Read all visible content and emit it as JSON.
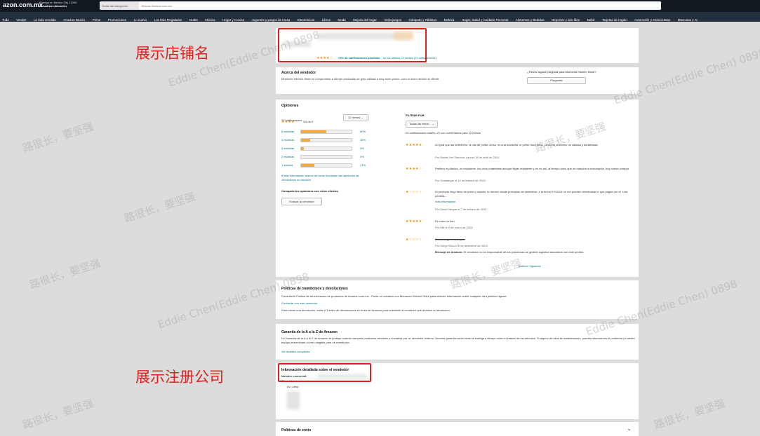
{
  "header": {
    "logo": "azon.com.mx",
    "deliver_line1": "Entrega en Mexico City 11000",
    "deliver_line2": "Actualizar ubicación",
    "search_category": "Todas las categorías",
    "search_placeholder": "Buscar Amazon.com.mx"
  },
  "nav": [
    "Todo",
    "Vender",
    "Lo más vendido",
    "Amazon Basics",
    "Prime",
    "Promociones",
    "Lo nuevo",
    "Los Más Regalados",
    "Outlet",
    "Música",
    "Hogar y Cocina",
    "Juguetes y juegos de mesa",
    "Electrónicos",
    "Libros",
    "Moda",
    "Mejora del hogar",
    "Videojuegos",
    "Cómputo y Tabletas",
    "Belleza",
    "Hogar, Salud y Cuidado Personal",
    "Alimentos y Bebidas",
    "Deportes y aire libre",
    "Bebé",
    "Tarjetas de regalo",
    "Automotriz y Motocicletas",
    "Mascotas y Ar"
  ],
  "seller_header": {
    "rating_stars": 4.5,
    "rating_link": "73% de calificaciones positivas",
    "rating_suffix": "en los últimos 12 meses (22 calificaciones)"
  },
  "about": {
    "title": "Acerca del vendedor",
    "text": "Momento Kitchen Store se compromete a ofrecer productos de gran calidad a muy buen precio, con un buen servicio al cliente.",
    "question": "¿Tienes alguna pregunta para Momento Kitchen Store?",
    "ask_button": "Preguntar"
  },
  "reviews_panel": {
    "title": "Opiniones",
    "score_text": "3.6 de 5",
    "count_text": "22 calificaciones",
    "period_select": "12 meses",
    "histogram": [
      {
        "label": "5 estrellas",
        "percent": 50
      },
      {
        "label": "4 estrellas",
        "percent": 18
      },
      {
        "label": "3 estrellas",
        "percent": 5
      },
      {
        "label": "2 estrellas",
        "percent": 0
      },
      {
        "label": "1 estrella",
        "percent": 27
      }
    ],
    "more_info": "Más información acerca de cómo funcionan las opiniones de vendedores en Amazon",
    "share_title": "Comparte tus opiniones con otros clientes",
    "evaluate_button": "Evaluar al vendedor",
    "filter_title": "FILTRAR POR",
    "filter_select": "Todas las estrel...",
    "summary": "22 calificaciones totales, 22 con comentarios para 12 meses",
    "next_link": "Anterior  Siguiente"
  },
  "reviews": [
    {
      "stars": 5,
      "text": "Al igual que las anteriores, la olla de peltre Cinsa, es una maravilla, el peltre dura años. Cinsa es sinónimo de calidad y durabilidad.",
      "author": "Por Rafael Ver Sánchez Lara el 19 de abril de 2024."
    },
    {
      "stars": 4,
      "text": "Prefiero el plástico, es resistente, los otros materiales aunque digan resistente y no es así, al tiempo claro que se mancha o desconpela, hoy buena compra.",
      "author": "Por Guadalupe el 10 de febrero de 2024."
    },
    {
      "stars": 1,
      "text": "El producto llegó lleno de polvo y rayado, lo devolví desde principios de diciembre, a la fecha 07/02/24 no me pueden reembolsar lo que pague por él. Una pérdida...",
      "more": "más información",
      "author": "Por David Vargas el 7 de febrero de 2024."
    },
    {
      "stars": 5,
      "text": "Es como la foto",
      "author": "Por Mili el 9 de enero de 2024."
    },
    {
      "stars": 1,
      "text": "Buena largo el artesano",
      "author": "Por Diego Silva el 5 de diciembre de 2023.",
      "response_label": "Mensaje de Amazon:",
      "response": "El vendedor no es responsable de los problemas de gestión logística asociados con este pedido."
    }
  ],
  "refunds": {
    "title": "Políticas de reembolsos y devoluciones",
    "line1": "Consulta la Política de devoluciones de productos de Amazon.com.mx . Ponte en contacto con Momento Kitchen Store para obtener información sobre cualquier otra política vigente.",
    "link": "Contactar con este vendedor",
    "line2": "Para iniciar una devolución, visita el Centro de devoluciones en línea de Amazon para solicitarle al vendedor que autorice la devolución."
  },
  "guarantee": {
    "title": "Garantía de la A a la Z de Amazon",
    "text": "La Garantía de la A a la Z de Amazon te protege cuando compras productos vendidos y enviados por un vendedor externo. Nuestra garantía cubre tanto la entrega a tiempo como el estado de los artículos. Si alguno de ellos es insatisfactorio, puedes informarnos el problema y nuestro equipo determinará si eres elegible para un reembolso.",
    "link": "Ver detalles completos"
  },
  "details": {
    "title": "Información detallada sobre el vendedor",
    "name_label": "Nombre comercial:",
    "address_label": "Dirección:",
    "address_line": "Av. Lafup"
  },
  "shipping": {
    "title": "Políticas de envío"
  },
  "annotations": {
    "store_name": "展示店铺名",
    "company": "展示注册公司"
  },
  "watermarks": [
    "路很长，要坚强",
    "Eddie Chen(Eddie Chen) 0898"
  ]
}
